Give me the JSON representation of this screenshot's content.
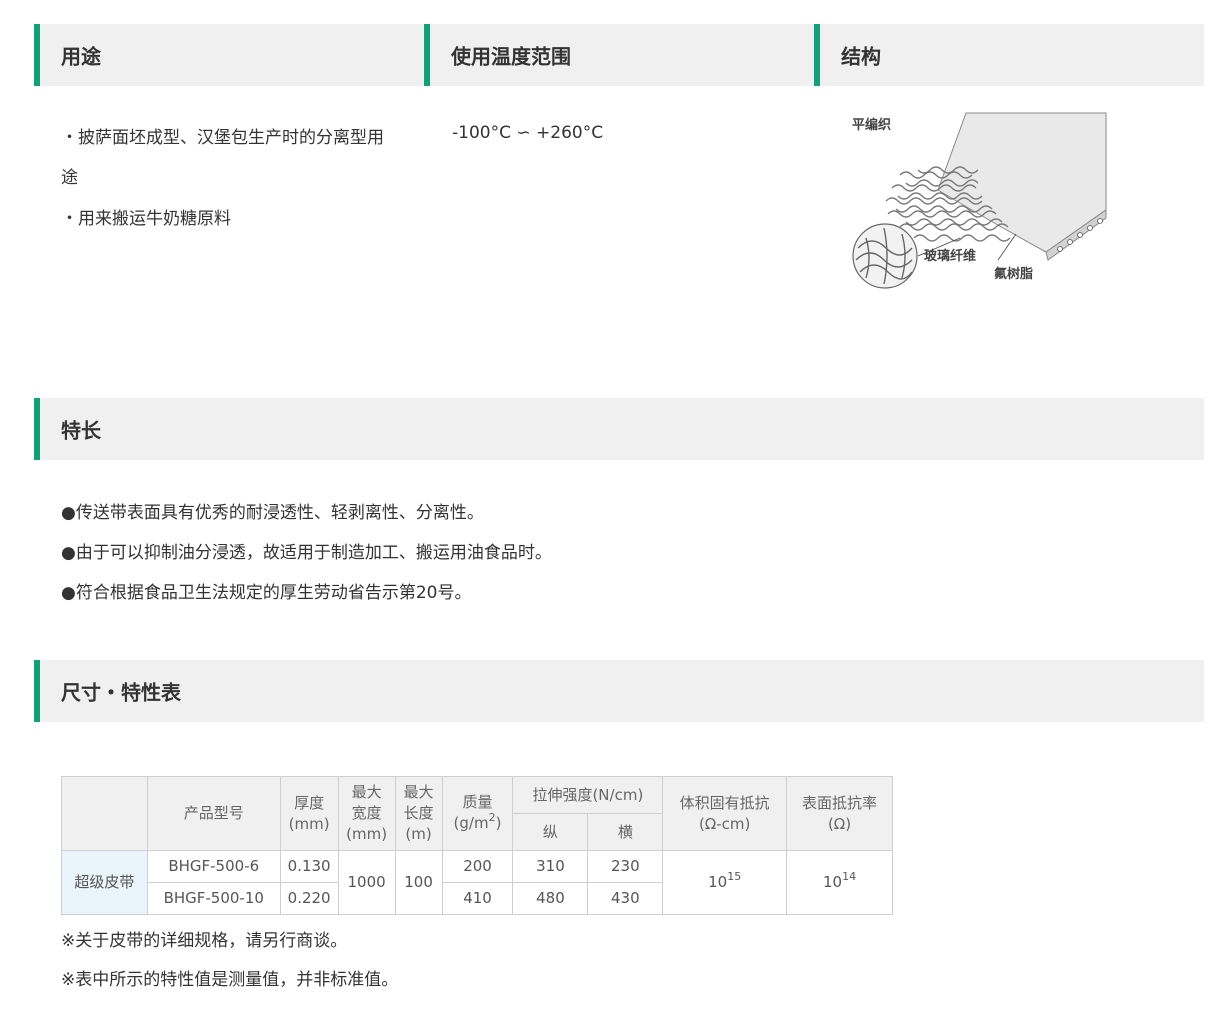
{
  "colors": {
    "accent": "#0fa27a",
    "header_bg": "#f0f0f0",
    "category_bg": "#eaf4fb"
  },
  "top_headers": {
    "usage": "用途",
    "temperature": "使用温度范围",
    "structure": "结构"
  },
  "usage": {
    "line1": "・披萨面坯成型、汉堡包生产时的分离型用",
    "line1_cont": "途",
    "line2": "・用来搬运牛奶糖原料"
  },
  "temperature": {
    "range": "-100°C ∽ +260°C"
  },
  "structure_diagram": {
    "label_weave": "平编织",
    "label_glass_fiber": "玻璃纤维",
    "label_resin": "氟树脂"
  },
  "features": {
    "title": "特长",
    "items": [
      "●传送带表面具有优秀的耐浸透性、轻剥离性、分离性。",
      "●由于可以抑制油分浸透，故适用于制造加工、搬运用油食品时。",
      "●符合根据食品卫生法规定的厚生劳动省告示第20号。"
    ]
  },
  "spec": {
    "title": "尺寸・特性表",
    "headers": {
      "model": "产品型号",
      "thickness_1": "厚度",
      "thickness_2": "(mm)",
      "max_width_1": "最大",
      "max_width_2": "宽度",
      "max_width_3": "(mm)",
      "max_length_1": "最大",
      "max_length_2": "长度",
      "max_length_3": "(m)",
      "mass_1": "质量",
      "mass_2": "(g/m",
      "mass_sup": "2",
      "mass_3": ")",
      "tensile": "拉伸强度(N/cm)",
      "tensile_long": "纵",
      "tensile_trans": "横",
      "volume_res_1": "体积固有抵抗",
      "volume_res_2": "(Ω-cm)",
      "surface_res_1": "表面抵抗率",
      "surface_res_2": "(Ω)"
    },
    "category": "超级皮带",
    "rows": [
      {
        "model": "BHGF-500-6",
        "thickness": "0.130",
        "mass": "200",
        "tensile_long": "310",
        "tensile_trans": "230"
      },
      {
        "model": "BHGF-500-10",
        "thickness": "0.220",
        "mass": "410",
        "tensile_long": "480",
        "tensile_trans": "430"
      }
    ],
    "shared": {
      "max_width": "1000",
      "max_length": "100",
      "volume_res_base": "10",
      "volume_res_exp": "15",
      "surface_res_base": "10",
      "surface_res_exp": "14"
    }
  },
  "notes": [
    "※关于皮带的详细规格，请另行商谈。",
    "※表中所示的特性值是测量值，并非标准值。"
  ]
}
